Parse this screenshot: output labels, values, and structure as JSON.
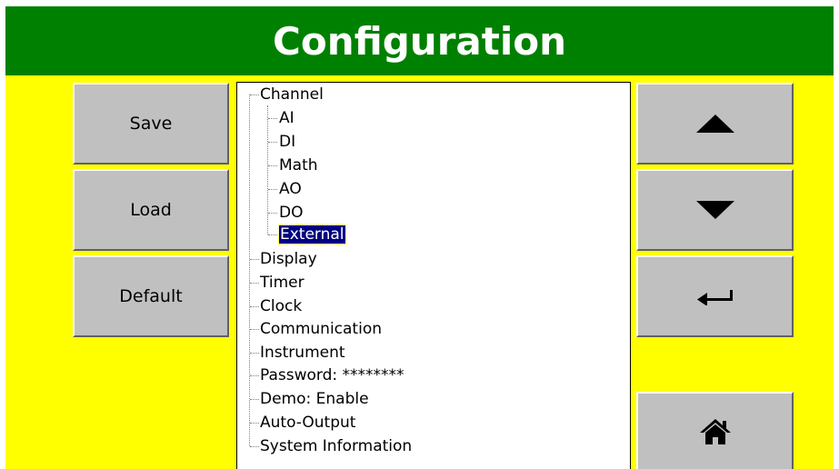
{
  "header": {
    "title": "Configuration"
  },
  "left_buttons": {
    "save": "Save",
    "load": "Load",
    "default": "Default"
  },
  "tree": {
    "channel": "Channel",
    "children": [
      "AI",
      "DI",
      "Math",
      "AO",
      "DO",
      "External"
    ],
    "selected": "External",
    "items": [
      "Display",
      "Timer",
      "Clock",
      "Communication",
      "Instrument",
      "Password: ********",
      "Demo: Enable",
      "Auto-Output",
      "System Information"
    ]
  },
  "right_buttons": {
    "up_icon": "up-arrow-icon",
    "down_icon": "down-arrow-icon",
    "enter_icon": "enter-icon",
    "home_icon": "home-icon"
  },
  "colors": {
    "header": "#008000",
    "background": "#ffff00",
    "selection": "#000080"
  }
}
